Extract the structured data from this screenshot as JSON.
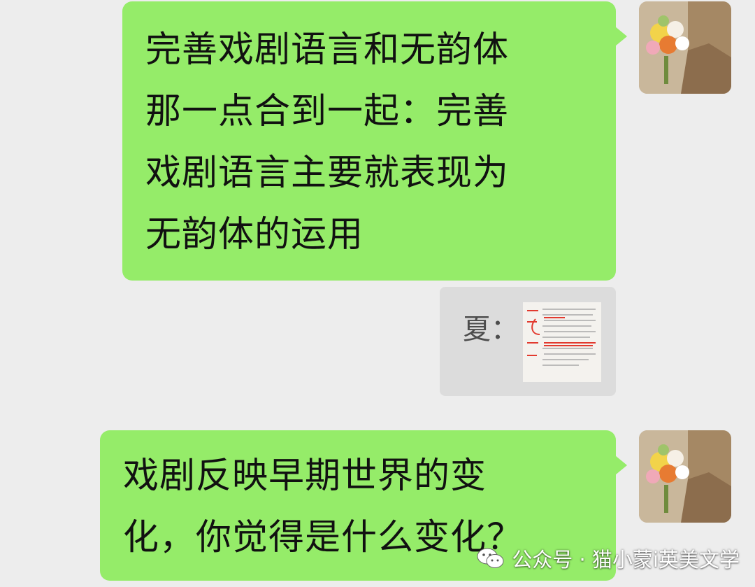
{
  "messages": [
    {
      "sender": "self",
      "lines": [
        "完善戏剧语言和无韵体",
        "那一点合到一起：完善",
        "戏剧语言主要就表现为",
        "无韵体的运用"
      ]
    },
    {
      "sender": "self",
      "lines": [
        "戏剧反映早期世界的变",
        "化，你觉得是什么变化？"
      ]
    }
  ],
  "quote": {
    "speaker": "夏：",
    "thumbnail_icon": "handwritten-notes-image"
  },
  "watermark": {
    "icon": "wechat-icon",
    "text": "公众号 · 猫小蒙i英美文学"
  },
  "colors": {
    "background": "#ededed",
    "bubble_self": "#95ec69",
    "quote_bg": "#dcdcdc"
  }
}
